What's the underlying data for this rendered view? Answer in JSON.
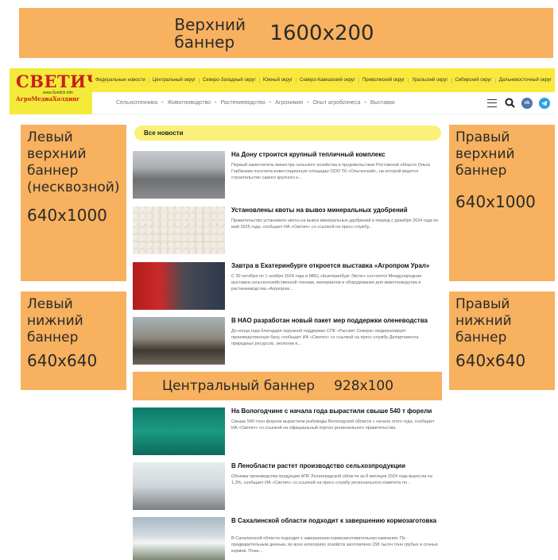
{
  "banners": {
    "top": {
      "label": "Верхний баннер",
      "size": "1600x200"
    },
    "left_top": {
      "label": "Левый верхний баннер (несквозной)",
      "size": "640x1000"
    },
    "left_bottom": {
      "label": "Левый нижний баннер",
      "size": "640x640"
    },
    "right_top": {
      "label": "Правый верхний баннер",
      "size": "640x1000"
    },
    "right_bottom": {
      "label": "Правый нижний баннер",
      "size": "640x640"
    },
    "center": {
      "label": "Центральный баннер",
      "size": "928x100"
    },
    "color": "#f7b15f"
  },
  "logo": {
    "name": "СВЕТИЧ",
    "url": "www.Svetich.info",
    "holding": "АгроМедиаХолдинг"
  },
  "regions": [
    "Федеральные новости",
    "Центральный округ",
    "Северо-Западный округ",
    "Южный округ",
    "Северо-Кавказский округ",
    "Приволжский округ",
    "Уральский округ",
    "Сибирский округ",
    "Дальневосточный округ"
  ],
  "topics": [
    "Сельхозтехника",
    "Животноводство",
    "Растениеводство",
    "Агрохимия",
    "Опыт агробизнеса",
    "Выставки"
  ],
  "icons": {
    "menu": "menu-icon",
    "search": "search-icon",
    "vk": "vk-icon",
    "telegram": "telegram-icon"
  },
  "vk_text": "vk",
  "section_title": "Все новости",
  "news": [
    {
      "title": "На Дону строится крупный тепличный комплекс",
      "text": "Первый заместитель министра сельского хозяйства и продовольствия Ростовской области Ольга Горбанева посетила инвестиционную площадку ООО ТК «Ольгинский», на которой ведется строительство самого крупного к..."
    },
    {
      "title": "Установлены квоты на вывоз минеральных удобрений",
      "text": "Правительство установило квоты на вывоз минеральных удобрений в период с декабря 2024 года по май 2025 года, сообщает ИА «Светич» со ссылкой на пресс-службу..."
    },
    {
      "title": "Завтра в Екатеринбурге откроется выставка «Агропром Урал»",
      "text": "С 30 октября по 1 ноября 2024 года в МВЦ «Екатеринбург-Экспо» состоится Международная выставка сельскохозяйственной техники, материалов и оборудования для животноводства и растениеводства «Агропром..."
    },
    {
      "title": "В НАО разработан новый пакет мер поддержки оленеводства",
      "text": "До конца года благодаря окружной поддержке СПК «Рассвет Севера» модернизирует производственную базу, сообщает ИА «Светич» со ссылкой на пресс-службу Департамента природных ресурсов, экологии и..."
    },
    {
      "title": "На Вологодчине с начала года вырастили свыше 540 т форели",
      "text": "Свыше 540 тонн форели вырастили рыбоводы Вологодской области с начала этого года, сообщает ИА «Светич» со ссылкой на официальный портал регионального правительства."
    },
    {
      "title": "В Ленобласти растет производство сельхозпродукции",
      "text": "Объемы производства продукции АПК Ленинградской области за 8 месяцев 2024 года выросли на 1,3%, сообщает ИА «Светич» со ссылкой на пресс-службу регионального комитета по..."
    },
    {
      "title": "В Сахалинской области подходит к завершению кормозаготовка",
      "text": "В Сахалинской области подходит к завершению кормозаготовительная кампания. По предварительным данным, во всех категориях хозяйств заготовлено 158 тысяч тонн грубых и сочных кормов. План..."
    }
  ]
}
